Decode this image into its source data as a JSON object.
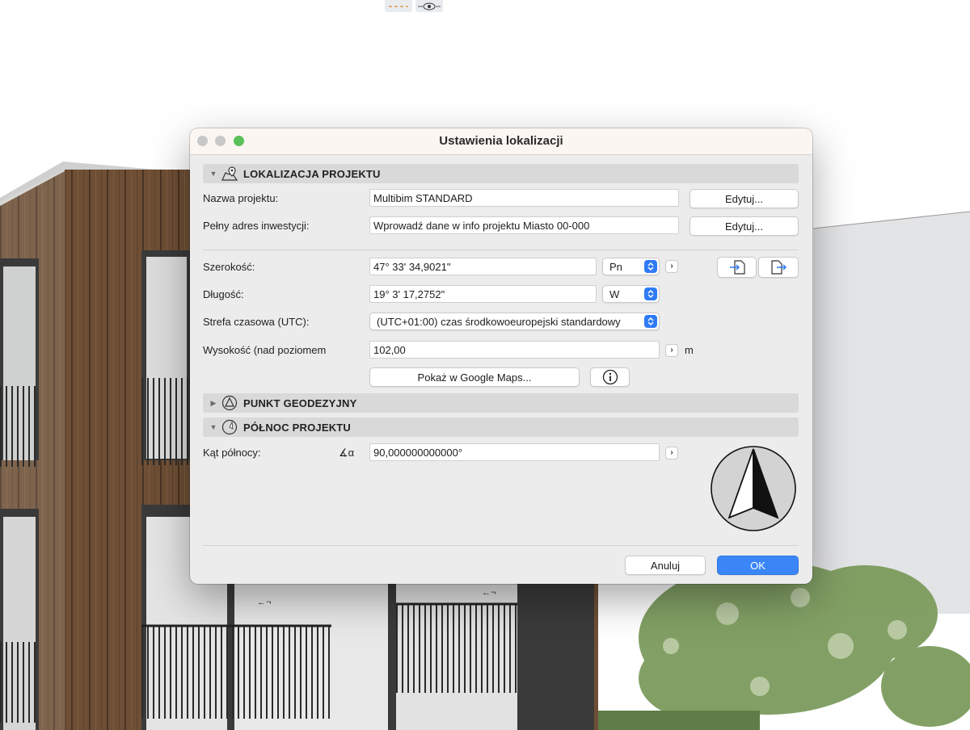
{
  "background": {
    "toolbar_icons": [
      "dashed-line-icon",
      "eye-icon"
    ],
    "annotations": [
      "←¬",
      "←¬"
    ]
  },
  "dialog": {
    "title": "Ustawienia lokalizacji",
    "sections": {
      "location": {
        "title": "LOKALIZACJA PROJEKTU",
        "icon": "map-pin-icon",
        "expanded": true
      },
      "geodetic": {
        "title": "PUNKT GEODEZYJNY",
        "icon": "triangle-point-icon",
        "expanded": false
      },
      "north": {
        "title": "PÓŁNOC PROJEKTU",
        "icon": "compass-icon",
        "expanded": true
      }
    },
    "project_name": {
      "label": "Nazwa projektu:",
      "value": "Multibim STANDARD",
      "button": "Edytuj..."
    },
    "address": {
      "label": "Pełny adres inwestycji:",
      "value": "Wprowadź dane w info projektu Miasto 00-000",
      "button": "Edytuj..."
    },
    "latitude": {
      "label": "Szerokość:",
      "value": "47° 33' 34,9021\"",
      "direction": "Pn"
    },
    "longitude": {
      "label": "Długość:",
      "value": "19° 3' 17,2752\"",
      "direction": "W"
    },
    "timezone": {
      "label": "Strefa czasowa (UTC):",
      "value": "(UTC+01:00) czas środkowoeuropejski standardowy"
    },
    "elevation": {
      "label": "Wysokość (nad poziomem",
      "value": "102,00",
      "unit": "m"
    },
    "maps_button": "Pokaż w Google Maps...",
    "north_angle": {
      "label": "Kąt północy:",
      "symbol": "∡α",
      "value": "90,000000000000°"
    },
    "buttons": {
      "cancel": "Anuluj",
      "ok": "OK"
    },
    "colors": {
      "accent": "#3b86f7",
      "close": "#c8c8c8",
      "zoom": "#5ac05a"
    }
  }
}
